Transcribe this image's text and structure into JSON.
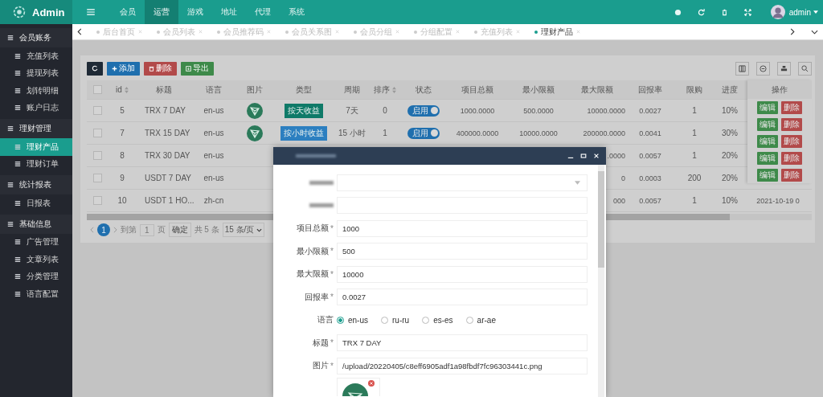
{
  "header": {
    "logo": "Admin",
    "nav": [
      {
        "label": "会员",
        "selected": false
      },
      {
        "label": "运营",
        "selected": true
      },
      {
        "label": "游戏",
        "selected": false
      },
      {
        "label": "地址",
        "selected": false
      },
      {
        "label": "代理",
        "selected": false
      },
      {
        "label": "系统",
        "selected": false
      }
    ],
    "user": "admin"
  },
  "tabs": [
    {
      "label": "后台首页",
      "selected": false
    },
    {
      "label": "会员列表",
      "selected": false
    },
    {
      "label": "会员推荐码",
      "selected": false
    },
    {
      "label": "会员关系图",
      "selected": false
    },
    {
      "label": "会员分组",
      "selected": false
    },
    {
      "label": "分组配置",
      "selected": false
    },
    {
      "label": "充值列表",
      "selected": false
    },
    {
      "label": "理财产品",
      "selected": true
    }
  ],
  "sidebar": {
    "groups": [
      {
        "label": "会员账务",
        "children": [
          {
            "label": "充值列表",
            "selected": false
          },
          {
            "label": "提现列表",
            "selected": false
          },
          {
            "label": "划转明细",
            "selected": false
          },
          {
            "label": "账户日志",
            "selected": false
          }
        ]
      },
      {
        "label": "理财管理",
        "children": [
          {
            "label": "理财产品",
            "selected": true
          },
          {
            "label": "理财订单",
            "selected": false
          }
        ]
      },
      {
        "label": "统计报表",
        "children": [
          {
            "label": "日报表",
            "selected": false
          }
        ]
      },
      {
        "label": "基础信息",
        "children": [
          {
            "label": "广告管理",
            "selected": false
          },
          {
            "label": "文章列表",
            "selected": false
          },
          {
            "label": "分类管理",
            "selected": false
          },
          {
            "label": "语言配置",
            "selected": false
          }
        ]
      }
    ]
  },
  "toolbar": {
    "buttons": [
      {
        "label": "添加",
        "kind": "add"
      },
      {
        "label": "删除",
        "kind": "delete"
      },
      {
        "label": "导出",
        "kind": "export"
      }
    ]
  },
  "table": {
    "all_checked": false,
    "columns": [
      {
        "label": "id",
        "sortable": true
      },
      {
        "label": "标题"
      },
      {
        "label": "语言"
      },
      {
        "label": "图片"
      },
      {
        "label": "类型"
      },
      {
        "label": "周期"
      },
      {
        "label": "排序",
        "sortable": true
      },
      {
        "label": "状态"
      },
      {
        "label": "项目总额"
      },
      {
        "label": "最小限额"
      },
      {
        "label": "最大限额"
      },
      {
        "label": "回报率"
      },
      {
        "label": "限购"
      },
      {
        "label": "进度"
      }
    ],
    "rows": [
      {
        "checked": false,
        "id": "5",
        "title": "TRX 7 DAY",
        "lang": "en-us",
        "logo": true,
        "type": {
          "label": "按天收益",
          "color": "#0f7a68"
        },
        "period": "7天",
        "sort": "0",
        "status": {
          "label": "启用",
          "on": true
        },
        "total": "1000.0000",
        "min": "500.0000",
        "max": "10000.0000",
        "rate": "0.0027",
        "limit": "1",
        "progress": "10%"
      },
      {
        "checked": false,
        "id": "7",
        "title": "TRX 15 DAY",
        "lang": "en-us",
        "logo": true,
        "type": {
          "label": "按小时收益",
          "color": "#2c7fc0"
        },
        "period": "15 小时",
        "sort": "1",
        "status": {
          "label": "启用",
          "on": true
        },
        "total": "400000.0000",
        "min": "10000.0000",
        "max": "200000.0000",
        "rate": "0.0041",
        "limit": "1",
        "progress": "30%"
      },
      {
        "checked": false,
        "id": "8",
        "title": "TRX 30 DAY",
        "lang": "en-us",
        "max": ".0000",
        "rate": "0.0057",
        "limit": "1",
        "progress": "20%"
      },
      {
        "checked": false,
        "id": "9",
        "title": "USDT 7 DAY",
        "lang": "en-us",
        "max": "0",
        "rate": "0.0003",
        "limit": "200",
        "progress": "20%"
      },
      {
        "checked": false,
        "id": "10",
        "title": "USDT 1 HO...",
        "lang": "zh-cn",
        "max": "000",
        "rate": "0.0057",
        "limit": "1",
        "progress": "10%",
        "extra": "2021-10-19 0"
      }
    ]
  },
  "actions": {
    "header": "操作",
    "rows": [
      {
        "edit": "编辑",
        "delete": "删除"
      },
      {
        "edit": "编辑",
        "delete": "删除"
      },
      {
        "edit": "编辑",
        "delete": "删除"
      },
      {
        "edit": "编辑",
        "delete": "删除"
      },
      {
        "edit": "编辑",
        "delete": "删除"
      }
    ]
  },
  "pagination": {
    "current": "1",
    "goto": "到第",
    "page": "1",
    "unit": "页",
    "confirm": "确定",
    "total": "共 5 条",
    "size": "15 条/页"
  },
  "dialog": {
    "fields": [
      {
        "label": "项目总额",
        "required": "*",
        "value": "1000"
      },
      {
        "label": "最小限额",
        "required": "*",
        "value": "500"
      },
      {
        "label": "最大限额",
        "required": "*",
        "value": "10000"
      },
      {
        "label": "回报率",
        "required": "*",
        "value": "0.0027"
      }
    ],
    "language": {
      "label": "语言",
      "options": [
        {
          "label": "en-us",
          "selected": true
        },
        {
          "label": "ru-ru",
          "selected": false
        },
        {
          "label": "es-es",
          "selected": false
        },
        {
          "label": "ar-ae",
          "selected": false
        }
      ]
    },
    "fields2": [
      {
        "label": "标题",
        "required": "*",
        "value": "TRX 7 DAY"
      },
      {
        "label": "图片",
        "required": "*",
        "value": "/upload/20220405/c8eff6905adf1a98fbdf7fc96303441c.png"
      }
    ]
  }
}
